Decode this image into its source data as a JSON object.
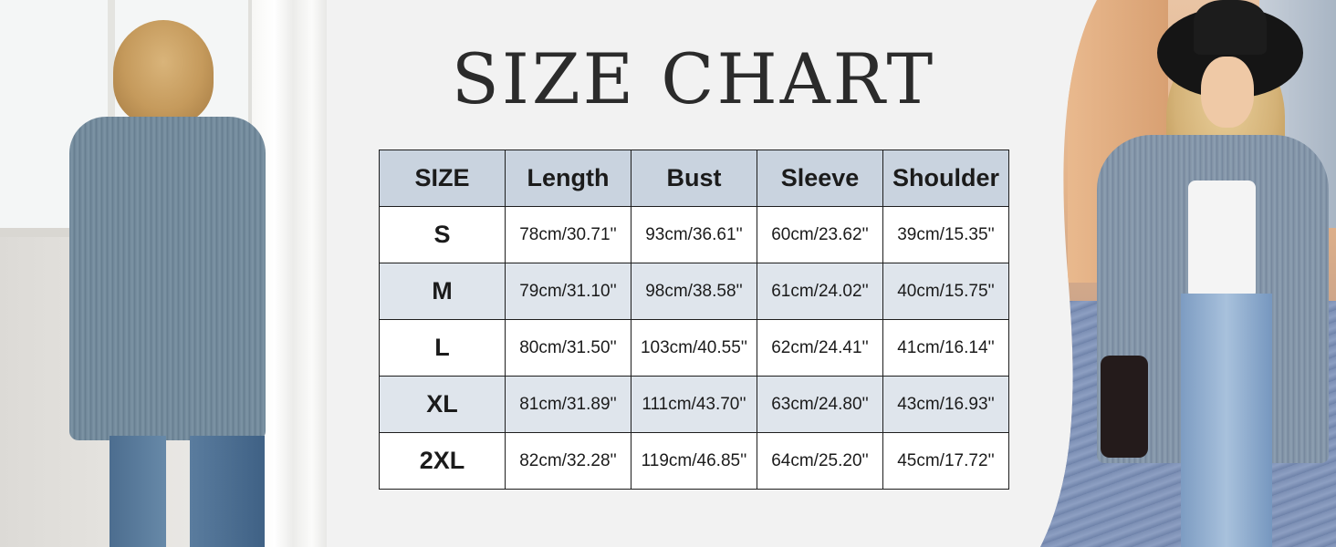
{
  "title": "SIZE CHART",
  "colors": {
    "header_bg": "#c9d3df",
    "row_alt_bg": "#dfe5ec",
    "row_bg": "#ffffff",
    "border": "#1e1e1e",
    "text": "#2b2b2b"
  },
  "table": {
    "headers": [
      "SIZE",
      "Length",
      "Bust",
      "Sleeve",
      "Shoulder"
    ],
    "rows": [
      [
        "S",
        "78cm/30.71''",
        "93cm/36.61''",
        "60cm/23.62''",
        "39cm/15.35''"
      ],
      [
        "M",
        "79cm/31.10''",
        "98cm/38.58''",
        "61cm/24.02''",
        "40cm/15.75''"
      ],
      [
        "L",
        "80cm/31.50''",
        "103cm/40.55''",
        "62cm/24.41''",
        "41cm/16.14''"
      ],
      [
        "XL",
        "81cm/31.89''",
        "111cm/43.70''",
        "63cm/24.80''",
        "43cm/16.93''"
      ],
      [
        "2XL",
        "82cm/32.28''",
        "119cm/46.85''",
        "64cm/25.20''",
        "45cm/17.72''"
      ]
    ]
  }
}
